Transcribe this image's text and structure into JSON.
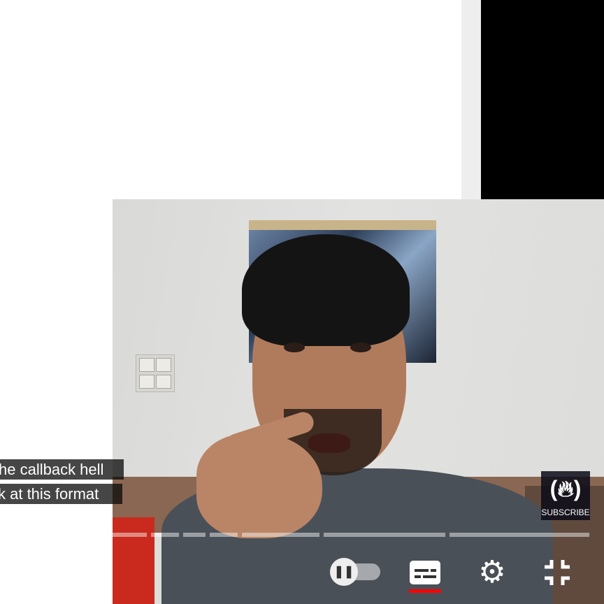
{
  "captions": {
    "line1": "he callback hell",
    "line2": "k at this format"
  },
  "subscribe_button": {
    "label": "SUBSCRIBE",
    "icon": "freecodecamp-logo-icon"
  },
  "player_controls": {
    "autoplay_toggle": {
      "icon": "pause-icon",
      "state": "off"
    },
    "subtitles_button": {
      "icon": "subtitles-icon",
      "active": true
    },
    "settings_button": {
      "icon": "gear-icon"
    },
    "exit_fullscreen_button": {
      "icon": "exit-fullscreen-icon"
    }
  },
  "colors": {
    "caption_background": "#080808",
    "active_underline": "#ff0000",
    "control_foreground": "#ffffff"
  }
}
